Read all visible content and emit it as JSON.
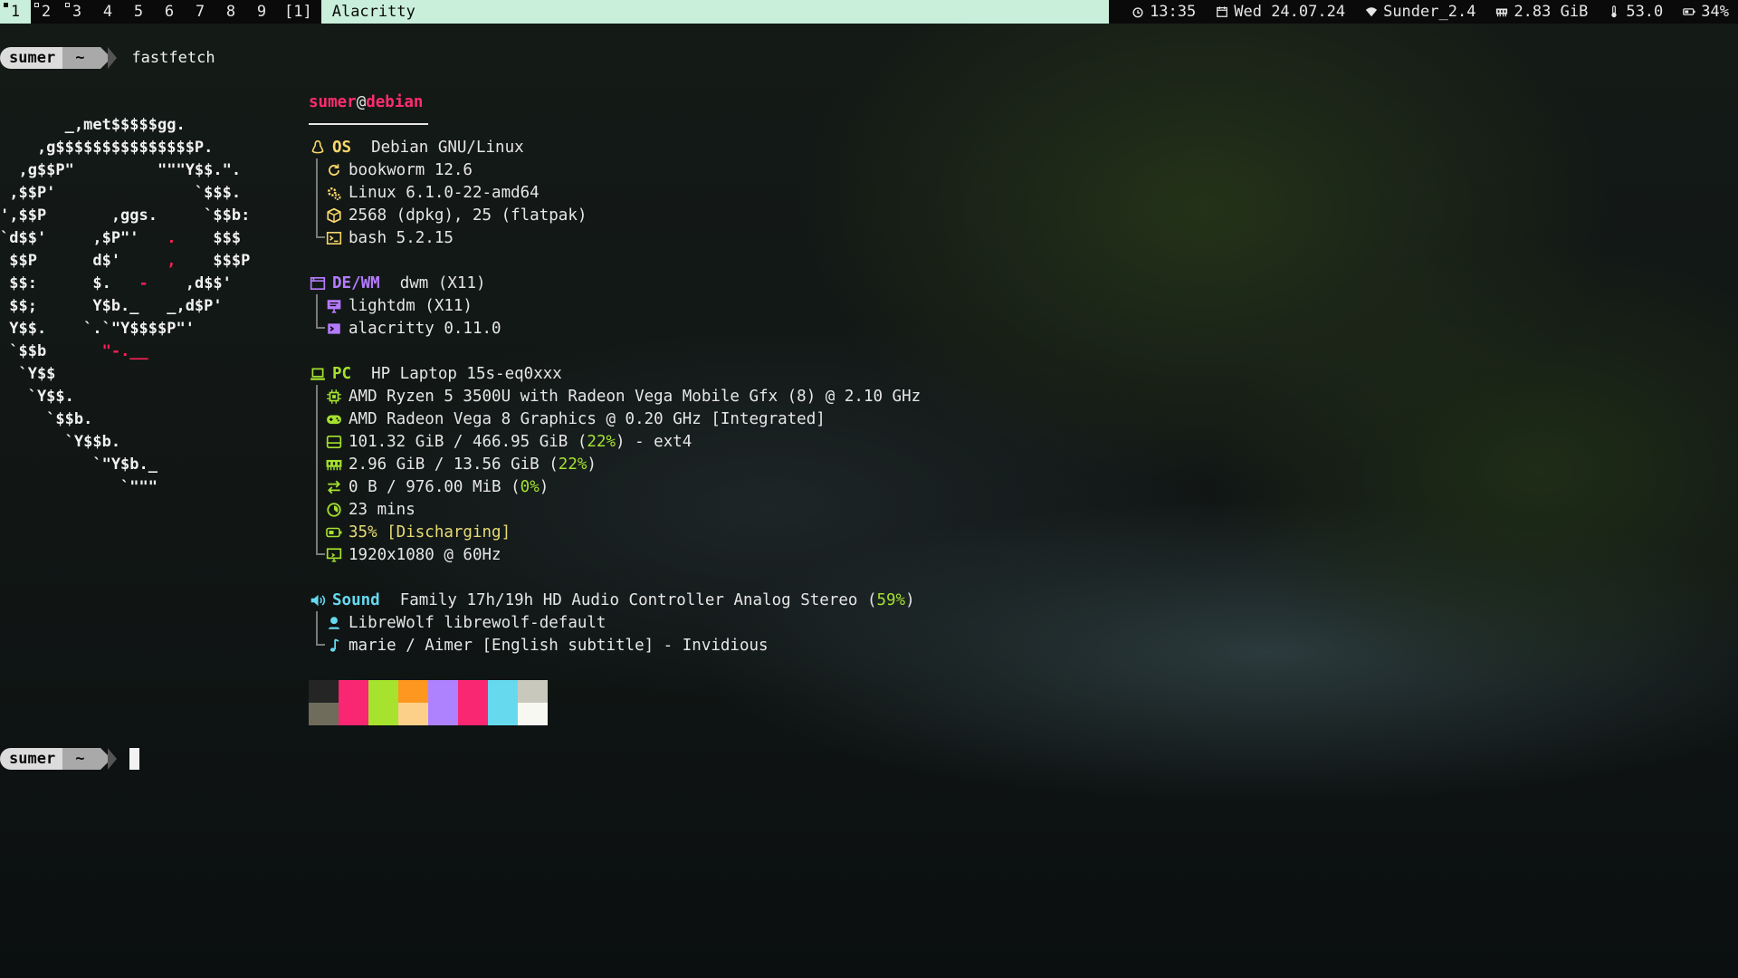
{
  "bar": {
    "tags": [
      "1",
      "2",
      "3",
      "4",
      "5",
      "6",
      "7",
      "8",
      "9"
    ],
    "layout": "[1]",
    "window_title": "Alacritty",
    "status": {
      "time": "13:35",
      "date": "Wed 24.07.24",
      "wifi": "Sunder_2.4",
      "memory": "2.83 GiB",
      "temperature": "53.0",
      "battery": "34%"
    }
  },
  "prompt": {
    "user": "sumer",
    "dir": "~",
    "command": "fastfetch"
  },
  "logo": [
    "       _,met$$$$$gg.",
    "    ,g$$$$$$$$$$$$$$$P.",
    "  ,g$$P\"         \"\"\"Y$$.\".",
    " ,$$P'               `$$$.",
    "',$$P       ,ggs.     `$$b:",
    "`d$$'     ,$P\"'   .    $$$",
    " $$P      d$'     ,    $$$P",
    " $$:      $.   -    ,d$$'",
    " $$;      Y$b._   _,d$P'",
    " Y$$.    `.`\"Y$$$$P\"'",
    " `$$b      \"-.__",
    "  `Y$$",
    "   `Y$$.",
    "     `$$b.",
    "       `Y$$b.",
    "          `\"Y$b._",
    "             `\"\"\""
  ],
  "info": {
    "user": "sumer",
    "at": "@",
    "host": "debian",
    "os_key": "OS",
    "os_value": "Debian GNU/Linux",
    "version": "bookworm 12.6",
    "kernel": "Linux 6.1.0-22-amd64",
    "packages": "2568 (dpkg), 25 (flatpak)",
    "shell": "bash 5.2.15",
    "dewm_key": "DE/WM",
    "dewm_value": "dwm (X11)",
    "lm": "lightdm (X11)",
    "terminal": "alacritty 0.11.0",
    "pc_key": "PC",
    "pc_value": "HP Laptop 15s-eq0xxx",
    "cpu": "AMD Ryzen 5 3500U with Radeon Vega Mobile Gfx (8) @ 2.10 GHz",
    "gpu": "AMD Radeon Vega 8 Graphics @ 0.20 GHz [Integrated]",
    "disk_a": "101.32 GiB / 466.95 GiB (",
    "disk_pct": "22%",
    "disk_b": ") - ext4",
    "mem_a": "2.96 GiB / 13.56 GiB (",
    "mem_pct": "22%",
    "mem_b": ")",
    "swap_a": "0 B / 976.00 MiB (",
    "swap_pct": "0%",
    "swap_b": ")",
    "uptime": "23 mins",
    "battery": "35% [Discharging]",
    "display": "1920x1080 @ 60Hz",
    "sound_key": "Sound",
    "sound_a": "Family 17h/19h HD Audio Controller Analog Stereo (",
    "sound_pct": "59%",
    "sound_b": ")",
    "player": "LibreWolf librewolf-default",
    "media": "marie / Aimer [English subtitle] - Invidious"
  },
  "colors": {
    "accent_teal": "#c9efdb",
    "red": "#ff2c70",
    "os_yellow": "#f9d86b",
    "dewm_purple": "#b57bff",
    "pc_green": "#a6e22e",
    "sound_cyan": "#66d9ef",
    "palette_top": [
      "#252525",
      "#f92672",
      "#a6e22e",
      "#fd971f",
      "#ae81ff",
      "#f92672",
      "#66d9ef",
      "#c8c8bc"
    ],
    "palette_bottom": [
      "#6f6c5c",
      "#f92672",
      "#a6e22e",
      "#fdd08a",
      "#ae81ff",
      "#f92672",
      "#66d9ef",
      "#f8f8f2"
    ]
  }
}
